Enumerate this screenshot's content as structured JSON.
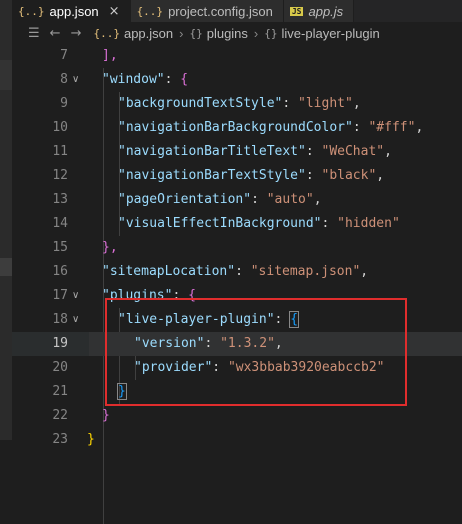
{
  "tabs": [
    {
      "icon": "{..}",
      "label": "app.json",
      "close": "×",
      "active": true
    },
    {
      "icon": "{..}",
      "label": "project.config.json",
      "active": false
    },
    {
      "icon": "JS",
      "label": "app.js",
      "active": false
    }
  ],
  "breadcrumb": {
    "list_icon": "☰",
    "back": "←",
    "forward": "→",
    "file_icon": "{..}",
    "file": "app.json",
    "sep": "›",
    "obj_icon": "{}",
    "items": [
      "plugins",
      "live-player-plugin"
    ]
  },
  "lines": [
    {
      "num": "7",
      "fold": ""
    },
    {
      "num": "8",
      "fold": "∨"
    },
    {
      "num": "9",
      "fold": ""
    },
    {
      "num": "10",
      "fold": ""
    },
    {
      "num": "11",
      "fold": ""
    },
    {
      "num": "12",
      "fold": ""
    },
    {
      "num": "13",
      "fold": ""
    },
    {
      "num": "14",
      "fold": ""
    },
    {
      "num": "15",
      "fold": ""
    },
    {
      "num": "16",
      "fold": ""
    },
    {
      "num": "17",
      "fold": "∨"
    },
    {
      "num": "18",
      "fold": "∨"
    },
    {
      "num": "19",
      "fold": ""
    },
    {
      "num": "20",
      "fold": ""
    },
    {
      "num": "21",
      "fold": ""
    },
    {
      "num": "22",
      "fold": ""
    },
    {
      "num": "23",
      "fold": ""
    }
  ],
  "code": {
    "l7": "],",
    "window_key": "\"window\"",
    "colon_brace": ": {",
    "bts_key": "\"backgroundTextStyle\"",
    "bts_val": "\"light\"",
    "nbbc_key": "\"navigationBarBackgroundColor\"",
    "nbbc_val": "\"#fff\"",
    "nbtt_key": "\"navigationBarTitleText\"",
    "nbtt_val": "\"WeChat\"",
    "nbts_key": "\"navigationBarTextStyle\"",
    "nbts_val": "\"black\"",
    "po_key": "\"pageOrientation\"",
    "po_val": "\"auto\"",
    "veib_key": "\"visualEffectInBackground\"",
    "veib_val": "\"hidden\"",
    "close_comma": "},",
    "sitemap_key": "\"sitemapLocation\"",
    "sitemap_val": "\"sitemap.json\"",
    "plugins_key": "\"plugins\"",
    "lpp_key": "\"live-player-plugin\"",
    "version_key": "\"version\"",
    "version_val": "\"1.3.2\"",
    "provider_key": "\"provider\"",
    "provider_val": "\"wx3bbab3920eabccb2\"",
    "close_brace": "}",
    "colon": ": ",
    "comma": ","
  },
  "colors": {
    "annotation_box": "#e02d2d",
    "key": "#9cdcfe",
    "string": "#ce9178"
  }
}
